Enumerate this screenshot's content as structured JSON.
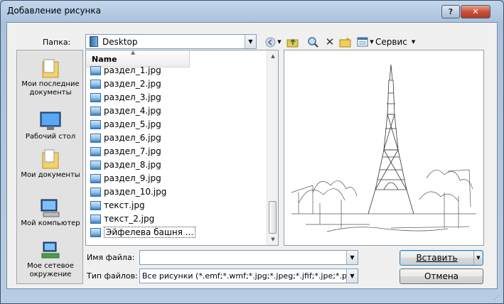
{
  "window": {
    "title": "Добавление рисунка"
  },
  "folder": {
    "label": "Папка:",
    "value": "Desktop"
  },
  "toolbar": {
    "tools_label": "Сервис"
  },
  "places": [
    {
      "label": "Мои последние документы"
    },
    {
      "label": "Рабочий стол"
    },
    {
      "label": "Мои документы"
    },
    {
      "label": "Мой компьютер"
    },
    {
      "label": "Мое сетевое окружение"
    }
  ],
  "filelist": {
    "column_name": "Name",
    "files": [
      "раздел_1.jpg",
      "раздел_2.jpg",
      "раздел_3.jpg",
      "раздел_4.jpg",
      "раздел_5.jpg",
      "раздел_6.jpg",
      "раздел_7.jpg",
      "раздел_8.jpg",
      "раздел_9.jpg",
      "раздел_10.jpg",
      "текст.jpg",
      "текст_2.jpg",
      "Эйфелева башня ..."
    ],
    "selected_index": 12
  },
  "filename": {
    "label": "Имя файла:",
    "value": ""
  },
  "filetype": {
    "label": "Тип файлов:",
    "value": "Все рисунки (*.emf;*.wmf;*.jpg;*.jpeg;*.jfif;*.jpe;*.png;"
  },
  "buttons": {
    "insert": "Вставить",
    "cancel": "Отмена"
  }
}
